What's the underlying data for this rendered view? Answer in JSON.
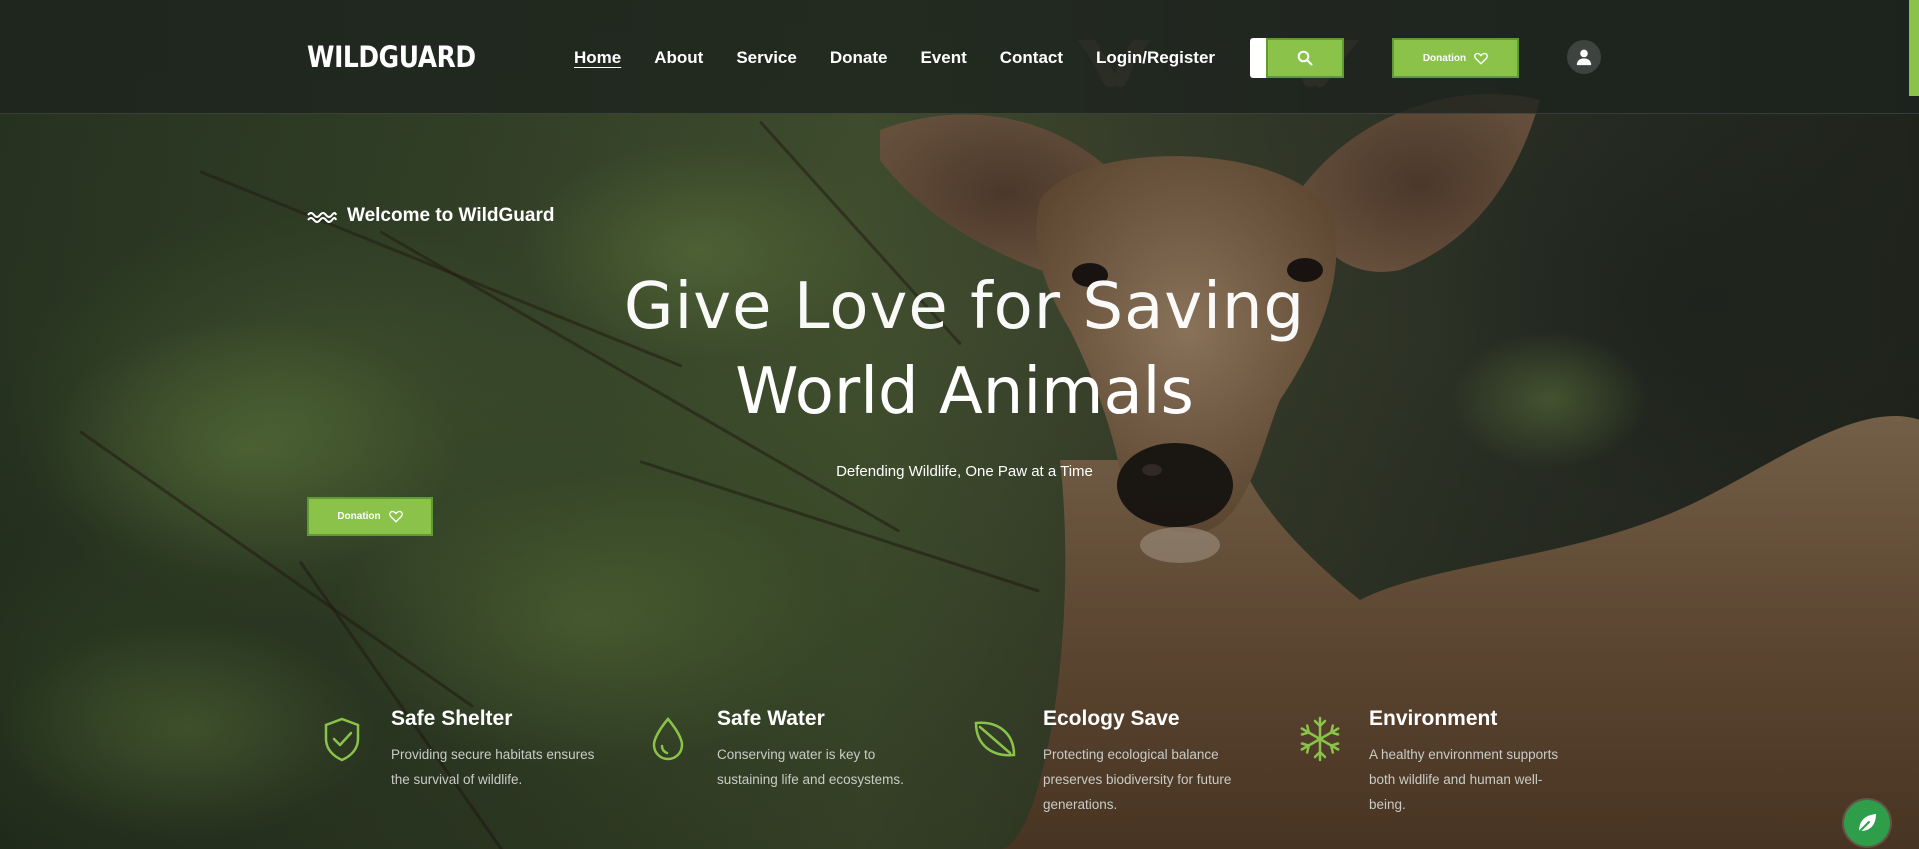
{
  "brand": {
    "logo": "WILDGUARD",
    "accent_color": "#8bc34a"
  },
  "nav": {
    "items": [
      {
        "label": "Home",
        "active": true
      },
      {
        "label": "About"
      },
      {
        "label": "Service"
      },
      {
        "label": "Donate"
      },
      {
        "label": "Event"
      },
      {
        "label": "Contact"
      },
      {
        "label": "Login/Register"
      }
    ],
    "search_icon": "search-icon",
    "donation_label": "Donation",
    "donation_icon": "heart-icon",
    "user_icon": "user-icon"
  },
  "hero": {
    "welcome": "Welcome to WildGuard",
    "welcome_icon": "wave-icon",
    "title_line1": "Give Love for Saving",
    "title_line2": "World Animals",
    "tagline": "Defending Wildlife, One Paw at a Time",
    "donation_label": "Donation"
  },
  "features": [
    {
      "title": "Safe Shelter",
      "text": "Providing secure habitats ensures the survival of wildlife.",
      "icon": "shield-check-icon"
    },
    {
      "title": "Safe Water",
      "text": "Conserving water is key to sustaining life and ecosystems.",
      "icon": "water-drop-icon"
    },
    {
      "title": "Ecology Save",
      "text": "Protecting ecological balance preserves biodiversity for future generations.",
      "icon": "leaf-icon"
    },
    {
      "title": "Environment",
      "text": "A healthy environment supports both wildlife and human well-being.",
      "icon": "snowflake-icon"
    }
  ],
  "chat_icon": "leaf-chat-icon"
}
